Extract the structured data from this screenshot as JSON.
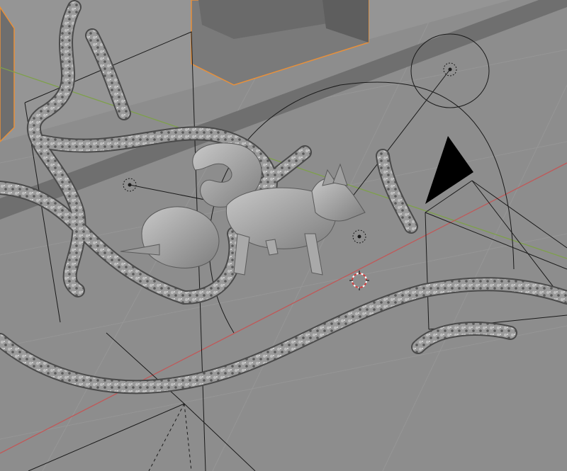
{
  "viewport": {
    "mode": "3d-viewport-solid-shading",
    "scene_objects": [
      {
        "kind": "fox-sculpt",
        "state": "unselected"
      },
      {
        "kind": "thorny-vines",
        "state": "unselected"
      },
      {
        "kind": "building-blocks",
        "state": "selected"
      },
      {
        "kind": "camera-frustum",
        "state": "unselected"
      },
      {
        "kind": "spot-light",
        "state": "unselected"
      },
      {
        "kind": "point-light",
        "state": "unselected"
      },
      {
        "kind": "3d-cursor",
        "state": "active"
      }
    ],
    "axis_colors": {
      "x": "#c05858",
      "y": "#7ea04a"
    },
    "selection_color": "#e8903a"
  }
}
